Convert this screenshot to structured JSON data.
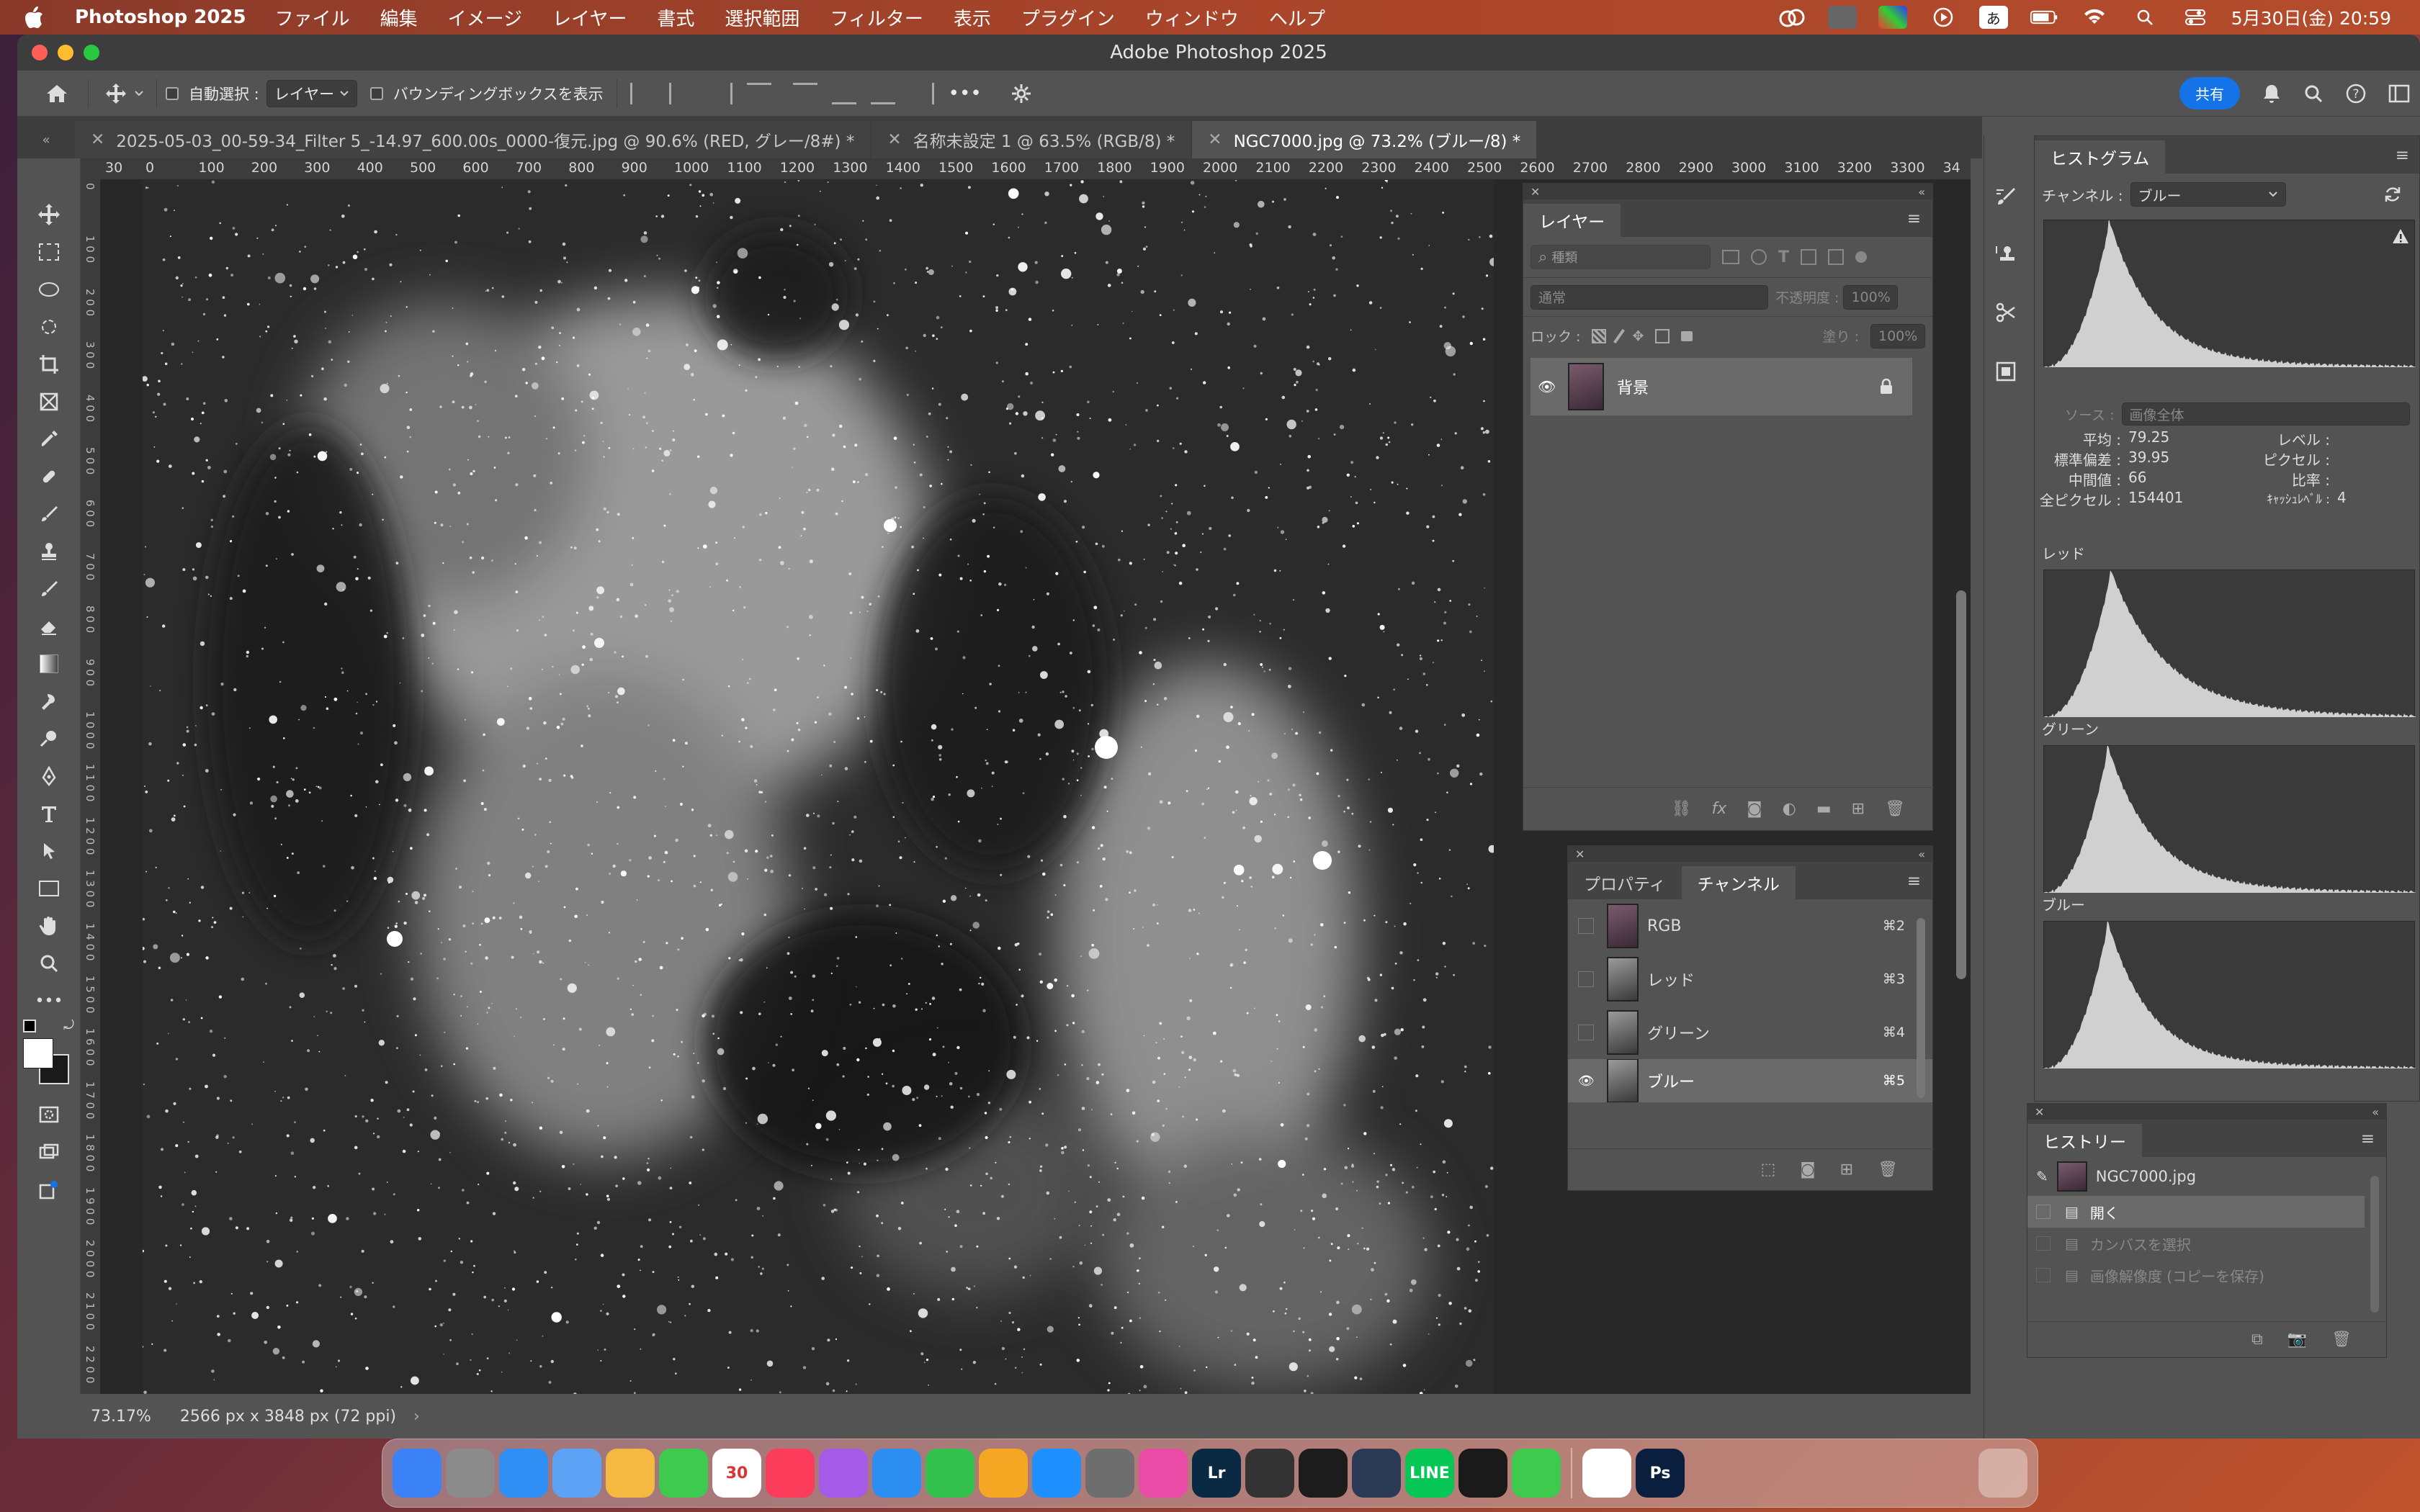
{
  "menubar": {
    "app_name": "Photoshop 2025",
    "items": [
      "ファイル",
      "編集",
      "イメージ",
      "レイヤー",
      "書式",
      "選択範囲",
      "フィルター",
      "表示",
      "プラグイン",
      "ウィンドウ",
      "ヘルプ"
    ],
    "ime": "あ",
    "datetime": "5月30日(金)  20:59"
  },
  "window": {
    "title": "Adobe Photoshop 2025"
  },
  "options": {
    "auto_select_label": "自動選択 :",
    "auto_select_value": "レイヤー",
    "bounding_box_label": "バウンディングボックスを表示",
    "share_label": "共有",
    "more": "•••"
  },
  "tabs": [
    {
      "title": "2025-05-03_00-59-34_Filter 5_-14.97_600.00s_0000-復元.jpg @ 90.6% (RED, グレー/8#) *"
    },
    {
      "title": "名称未設定 1 @ 63.5% (RGB/8) *"
    },
    {
      "title": "NGC7000.jpg @ 73.2% (ブルー/8) *"
    }
  ],
  "ruler": {
    "h": [
      "30",
      "0",
      "100",
      "200",
      "300",
      "400",
      "500",
      "600",
      "700",
      "800",
      "900",
      "1000",
      "1100",
      "1200",
      "1300",
      "1400",
      "1500",
      "1600",
      "1700",
      "1800",
      "1900",
      "2000",
      "2100",
      "2200",
      "2300",
      "2400",
      "2500",
      "2600",
      "2700",
      "2800",
      "2900",
      "3000",
      "3100",
      "3200",
      "3300",
      "34"
    ],
    "v": [
      "0",
      "1 0 0",
      "2 0 0",
      "3 0 0",
      "4 0 0",
      "5 0 0",
      "6 0 0",
      "7 0 0",
      "8 0 0",
      "9 0 0",
      "1 0 0 0",
      "1 1 0 0",
      "1 2 0 0",
      "1 3 0 0",
      "1 4 0 0",
      "1 5 0 0",
      "1 6 0 0",
      "1 7 0 0",
      "1 8 0 0",
      "1 9 0 0",
      "2 0 0 0",
      "2 1 0 0",
      "2 2 0 0",
      "2 3 0 0"
    ]
  },
  "status": {
    "zoom": "73.17%",
    "doc_size": "2566 px x 3848 px (72 ppi)"
  },
  "layers_panel": {
    "tab": "レイヤー",
    "filter_placeholder": "種類",
    "blend_mode": "通常",
    "opacity_label": "不透明度 :",
    "opacity_value": "100%",
    "lock_label": "ロック :",
    "fill_label": "塗り :",
    "fill_value": "100%",
    "layers": [
      {
        "name": "背景"
      }
    ]
  },
  "channels_panel": {
    "tabs": [
      "プロパティ",
      "チャンネル"
    ],
    "channels": [
      {
        "name": "RGB",
        "shortcut": "⌘2"
      },
      {
        "name": "レッド",
        "shortcut": "⌘3"
      },
      {
        "name": "グリーン",
        "shortcut": "⌘4"
      },
      {
        "name": "ブルー",
        "shortcut": "⌘5"
      }
    ]
  },
  "histogram_panel": {
    "tab": "ヒストグラム",
    "channel_label": "チャンネル :",
    "channel_value": "ブルー",
    "source_label": "ソース :",
    "source_value": "画像全体",
    "stats": {
      "mean_label": "平均 :",
      "mean": "79.25",
      "stddev_label": "標準偏差 :",
      "stddev": "39.95",
      "median_label": "中間値 :",
      "median": "66",
      "pixels_label": "全ピクセル :",
      "pixels": "154401",
      "level_label": "レベル :",
      "count_label": "ピクセル :",
      "percentile_label": "比率 :",
      "cache_label": "ｷｬｯｼｭﾚﾍﾞﾙ :",
      "cache": "4"
    },
    "channel_hists": [
      "レッド",
      "グリーン",
      "ブルー"
    ]
  },
  "history_panel": {
    "tab": "ヒストリー",
    "snapshot": "NGC7000.jpg",
    "states": [
      "開く",
      "カンバスを選択",
      "画像解像度 (コピーを保存)"
    ]
  },
  "dock": {
    "apps": [
      {
        "label": "",
        "color": "#3b82f6"
      },
      {
        "label": "",
        "color": "#8b8b8b"
      },
      {
        "label": "",
        "color": "#2f8ff5"
      },
      {
        "label": "",
        "color": "#5da3f5"
      },
      {
        "label": "",
        "color": "#f5b841"
      },
      {
        "label": "",
        "color": "#3ec94f"
      },
      {
        "label": "30",
        "color": "#ffffff"
      },
      {
        "label": "",
        "color": "#fb3c5a"
      },
      {
        "label": "",
        "color": "#a65ae8"
      },
      {
        "label": "",
        "color": "#2b8ef0"
      },
      {
        "label": "",
        "color": "#32c24d"
      },
      {
        "label": "",
        "color": "#f5a623"
      },
      {
        "label": "",
        "color": "#1e90ff"
      },
      {
        "label": "",
        "color": "#6e6e6e"
      },
      {
        "label": "",
        "color": "#e94ba7"
      },
      {
        "label": "Lr",
        "color": "#0a2a44"
      },
      {
        "label": "",
        "color": "#333333"
      },
      {
        "label": "",
        "color": "#1c1c1c"
      },
      {
        "label": "",
        "color": "#2b3a55"
      },
      {
        "label": "LINE",
        "color": "#06c755"
      },
      {
        "label": "",
        "color": "#1a1a1a"
      },
      {
        "label": "",
        "color": "#3ec94f"
      },
      {
        "label": "",
        "color": "#ffffff"
      },
      {
        "label": "Ps",
        "color": "#0a1f3d"
      }
    ]
  },
  "colors": {
    "accent": "#1473e6",
    "panel": "#535353",
    "dark": "#3a3a3a"
  }
}
